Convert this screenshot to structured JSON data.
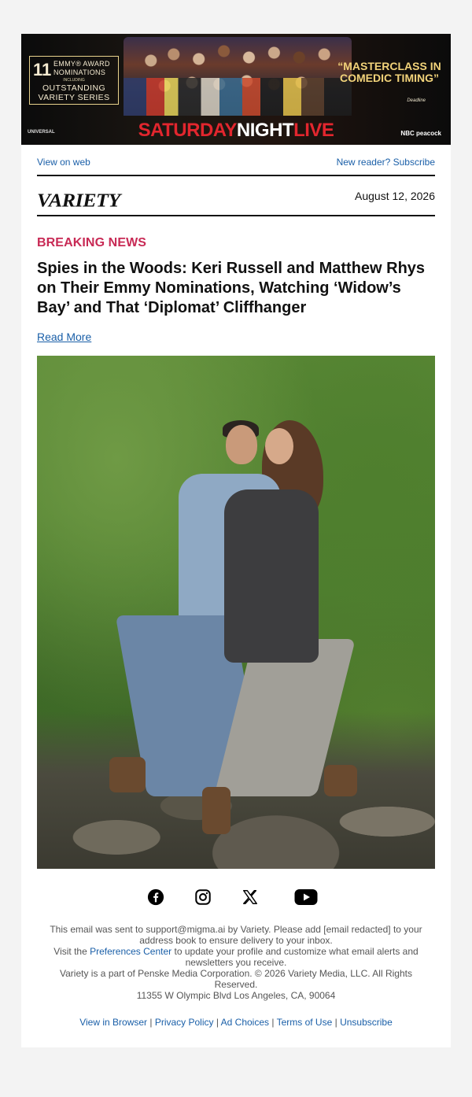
{
  "ad_banner": {
    "emmy_number": "11",
    "emmy_line1": "EMMY® AWARD",
    "emmy_line2": "NOMINATIONS",
    "emmy_small": "INCLUDING",
    "emmy_line3": "OUTSTANDING",
    "emmy_line4": "VARIETY SERIES",
    "quote": "“MASTERCLASS IN COMEDIC TIMING”",
    "quote_source": "Deadline",
    "title_part1": "SATURDAY",
    "title_part2": "NIGHT",
    "title_part3": "LIVE",
    "studio": "UNIVERSAL",
    "networks": "NBC  peacock"
  },
  "header": {
    "view_on_web": "View on web",
    "subscribe": "New reader? Subscribe",
    "logo": "VARIETY",
    "date": "August 12, 2026"
  },
  "article": {
    "kicker": "BREAKING NEWS",
    "headline": "Spies in the Woods: Keri Russell and Matthew Rhys on Their Emmy Nominations, Watching ‘Widow’s Bay’ and That ‘Diplomat’ Cliffhanger",
    "read_more": "Read More"
  },
  "social": [
    "facebook-icon",
    "instagram-icon",
    "x-icon",
    "youtube-icon"
  ],
  "footer": {
    "line1": "This email was sent to support@migma.ai by Variety. Please add [email redacted] to your address book to ensure delivery to your inbox.",
    "line2_prefix": "Visit the ",
    "line2_link": "Preferences Center",
    "line2_suffix": " to update your profile and customize what email alerts and newsletters you receive.",
    "line3": "Variety is a part of Penske Media Corporation. © 2026 Variety Media, LLC. All Rights Reserved.",
    "line4": "11355 W Olympic Blvd Los Angeles, CA, 90064",
    "links": {
      "view_browser": "View in Browser",
      "privacy": "Privacy Policy",
      "ad_choices": "Ad Choices",
      "terms": "Terms of Use",
      "unsubscribe": "Unsubscribe",
      "separator": " | "
    }
  }
}
